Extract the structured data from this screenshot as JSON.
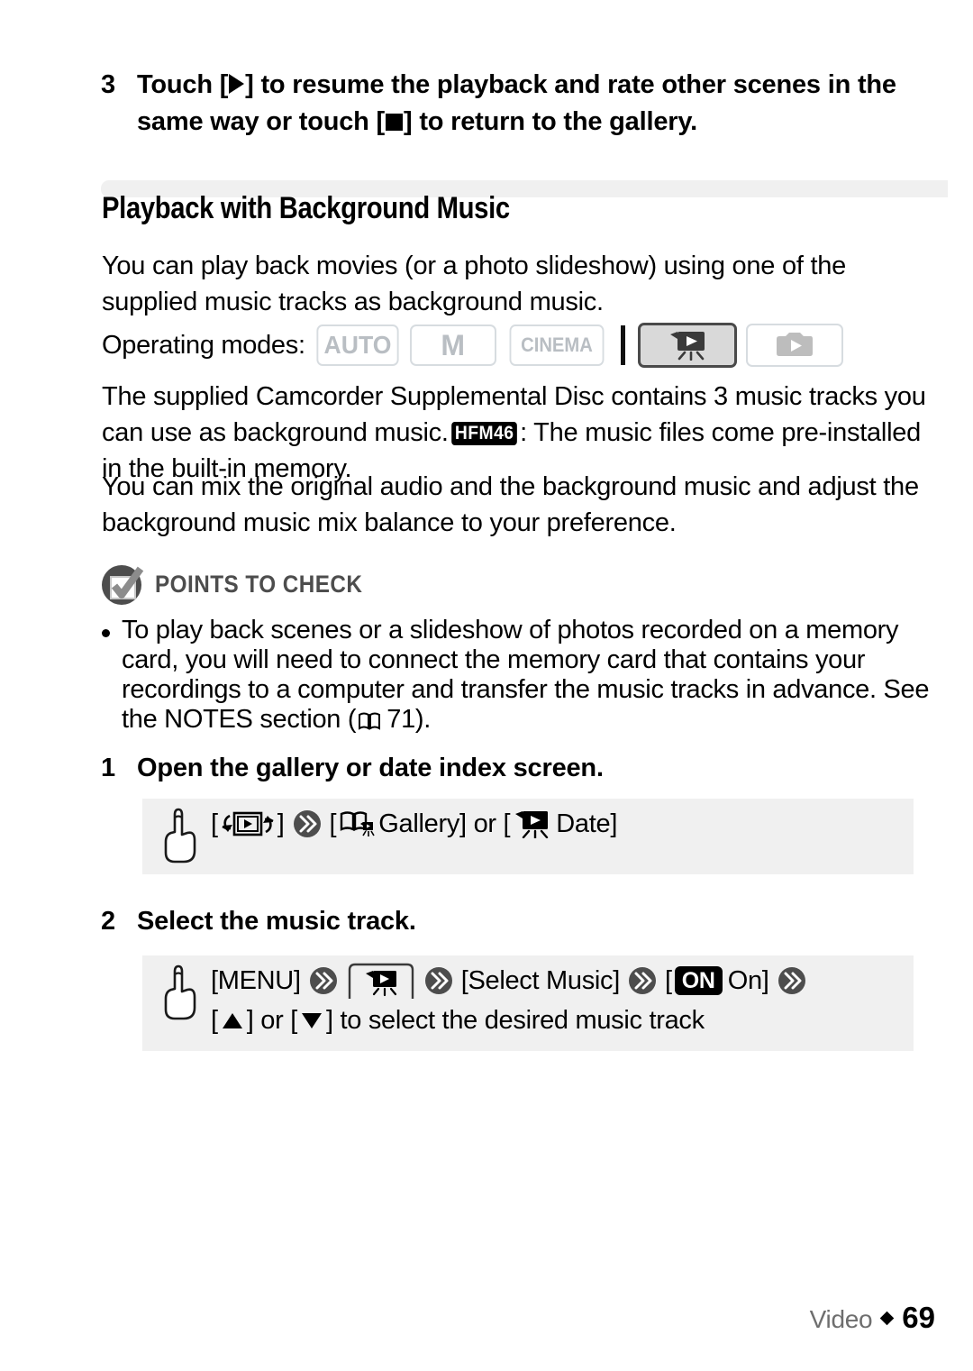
{
  "step_top": {
    "number": "3",
    "text_a": "Touch [",
    "icon_play": "play-triangle-icon",
    "text_b": "] to resume the playback and rate other scenes in the same way or touch [",
    "icon_stop": "stop-square-icon",
    "text_c": "] to return to the gallery."
  },
  "section": {
    "title": "Playback with Background Music",
    "intro": "You can play back movies (or a photo slideshow) using one of the supplied music tracks as background music."
  },
  "operating_modes": {
    "label": "Operating modes:",
    "badges": [
      {
        "label": "AUTO",
        "state": "disabled"
      },
      {
        "label": "M",
        "state": "disabled"
      },
      {
        "label": "CINEMA",
        "state": "disabled"
      }
    ],
    "icon_modes": [
      {
        "icon": "movie-playback-icon",
        "state": "active"
      },
      {
        "icon": "photo-playback-icon",
        "state": "disabled"
      }
    ]
  },
  "body": {
    "para1_a": "The supplied Camcorder Supplemental Disc contains 3 music tracks you can use as background music.",
    "badge": "HFM46",
    "para1_b": ": The music files come pre-installed in the built-in memory.",
    "para2": "You can mix the original audio and the background music and adjust the background music mix balance to your preference."
  },
  "points_to_check": {
    "heading": "POINTS TO CHECK",
    "icon": "checkbox-check-icon",
    "bullet_a": "To play back scenes or a slideshow of photos recorded on a memory card, you will need to connect the memory card that contains your recordings to a computer and transfer the music tracks in advance. See the NOTES section (",
    "bullet_icon": "open-book-icon",
    "bullet_page": "71",
    "bullet_b": ")."
  },
  "steps": [
    {
      "number": "1",
      "title": "Open the gallery or date index screen.",
      "procedure": {
        "hand_icon": "pointing-hand-icon",
        "line1": [
          {
            "type": "text",
            "value": "["
          },
          {
            "type": "icon",
            "value": "playback-mode-icon"
          },
          {
            "type": "text",
            "value": "]"
          },
          {
            "type": "arrow",
            "value": "double-chevron-icon"
          },
          {
            "type": "text",
            "value": "["
          },
          {
            "type": "icon",
            "value": "gallery-book-icon"
          },
          {
            "type": "text",
            "value": " Gallery] or ["
          },
          {
            "type": "icon",
            "value": "movie-camera-icon"
          },
          {
            "type": "text",
            "value": " Date]"
          }
        ]
      }
    },
    {
      "number": "2",
      "title": "Select the music track.",
      "procedure": {
        "hand_icon": "pointing-hand-icon",
        "line1": [
          {
            "type": "text",
            "value": "[MENU]"
          },
          {
            "type": "arrow",
            "value": "double-chevron-icon"
          },
          {
            "type": "icon",
            "value": "video-tab-icon"
          },
          {
            "type": "arrow",
            "value": "double-chevron-icon"
          },
          {
            "type": "text",
            "value": "[Select Music]"
          },
          {
            "type": "arrow",
            "value": "double-chevron-icon"
          },
          {
            "type": "text",
            "value": "["
          },
          {
            "type": "badge",
            "value": "ON"
          },
          {
            "type": "text",
            "value": " On]"
          },
          {
            "type": "arrow",
            "value": "double-chevron-icon"
          }
        ],
        "line2_a": "[",
        "line2_up": "triangle-up-icon",
        "line2_b": "] or [",
        "line2_down": "triangle-down-icon",
        "line2_c": "] to select the desired music track"
      }
    }
  ],
  "footer": {
    "label": "Video",
    "separator": "diamond-icon",
    "page": "69"
  },
  "colors": {
    "page_bg": "#ffffff",
    "text": "#000000",
    "box_gray": "#f0f0f0",
    "badge_disabled": "#b9bec3",
    "badge_border": "#d7dce0",
    "ptc_gray": "#4d4d4d",
    "arrow_gray": "#4d4d4d",
    "footer_gray": "#6e6e6e"
  }
}
